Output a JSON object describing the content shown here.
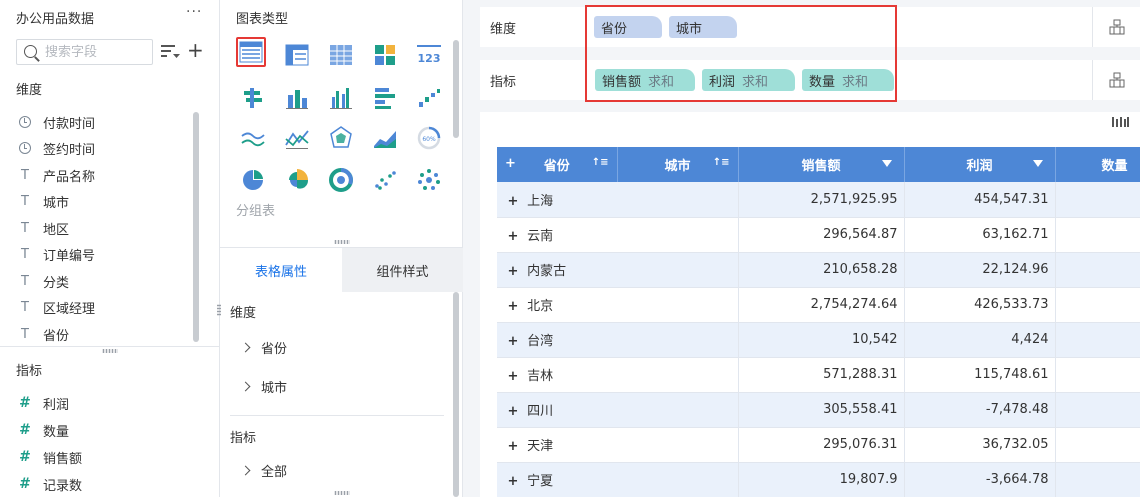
{
  "left_panel": {
    "title": "办公用品数据",
    "more": "···",
    "search": {
      "placeholder": "搜索字段",
      "value": ""
    },
    "dimension_label": "维度",
    "dimension_fields": [
      {
        "name": "付款时间",
        "icon": "clock-icon"
      },
      {
        "name": "签约时间",
        "icon": "clock-icon"
      },
      {
        "name": "产品名称",
        "icon": "text-type-icon"
      },
      {
        "name": "城市",
        "icon": "text-type-icon"
      },
      {
        "name": "地区",
        "icon": "text-type-icon"
      },
      {
        "name": "订单编号",
        "icon": "text-type-icon"
      },
      {
        "name": "分类",
        "icon": "text-type-icon"
      },
      {
        "name": "区域经理",
        "icon": "text-type-icon"
      },
      {
        "name": "省份",
        "icon": "text-type-icon"
      }
    ],
    "metric_label": "指标",
    "metric_fields": [
      {
        "name": "利润",
        "icon": "hash-icon"
      },
      {
        "name": "数量",
        "icon": "hash-icon"
      },
      {
        "name": "销售额",
        "icon": "hash-icon"
      },
      {
        "name": "记录数",
        "icon": "hash-icon"
      }
    ]
  },
  "middle_panel": {
    "chart_type_title": "图表类型",
    "group_label": "分组表",
    "tabs": {
      "active": "表格属性",
      "inactive": "组件样式"
    },
    "props": {
      "dimension_label": "维度",
      "dimension_items": [
        "省份",
        "城市"
      ],
      "metric_label": "指标",
      "metric_items": [
        "全部"
      ]
    }
  },
  "shelves": {
    "dimension": {
      "label": "维度",
      "pills": [
        "省份",
        "城市"
      ]
    },
    "metric": {
      "label": "指标",
      "pills": [
        {
          "name": "销售额",
          "agg": "求和"
        },
        {
          "name": "利润",
          "agg": "求和"
        },
        {
          "name": "数量",
          "agg": "求和"
        }
      ]
    }
  },
  "table": {
    "plus": "+",
    "headers": {
      "province": "省份",
      "city": "城市",
      "sales": "销售额",
      "profit": "利润",
      "qty": "数量"
    },
    "rows": [
      {
        "province": "上海",
        "sales": "2,571,925.95",
        "profit": "454,547.31"
      },
      {
        "province": "云南",
        "sales": "296,564.87",
        "profit": "63,162.71"
      },
      {
        "province": "内蒙古",
        "sales": "210,658.28",
        "profit": "22,124.96"
      },
      {
        "province": "北京",
        "sales": "2,754,274.64",
        "profit": "426,533.73"
      },
      {
        "province": "台湾",
        "sales": "10,542",
        "profit": "4,424"
      },
      {
        "province": "吉林",
        "sales": "571,288.31",
        "profit": "115,748.61"
      },
      {
        "province": "四川",
        "sales": "305,558.41",
        "profit": "-7,478.48"
      },
      {
        "province": "天津",
        "sales": "295,076.31",
        "profit": "36,732.05"
      },
      {
        "province": "宁夏",
        "sales": "19,807.9",
        "profit": "-3,664.78"
      }
    ]
  },
  "colors": {
    "accent": "#1a73e8",
    "header_blue": "#4d87d6",
    "dimension_pill": "#c3d3ef",
    "metric_pill": "#9fdfd8",
    "highlight": "#e53935"
  }
}
